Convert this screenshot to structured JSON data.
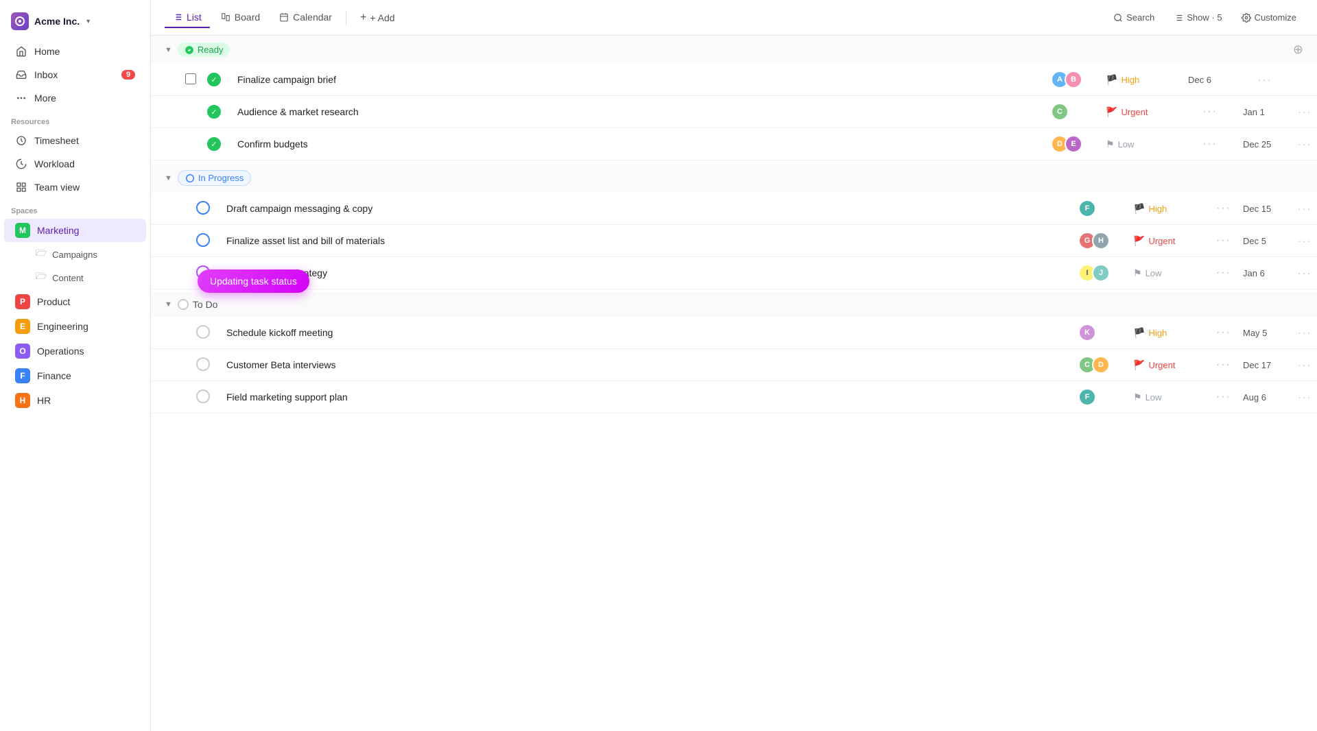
{
  "app": {
    "company": "Acme Inc.",
    "company_arrow": "▾"
  },
  "sidebar": {
    "nav": [
      {
        "id": "home",
        "label": "Home",
        "icon": "home"
      },
      {
        "id": "inbox",
        "label": "Inbox",
        "icon": "inbox",
        "badge": "9"
      },
      {
        "id": "more",
        "label": "More",
        "icon": "more"
      }
    ],
    "resources_label": "Resources",
    "resources": [
      {
        "id": "timesheet",
        "label": "Timesheet",
        "icon": "timesheet"
      },
      {
        "id": "workload",
        "label": "Workload",
        "icon": "workload"
      },
      {
        "id": "teamview",
        "label": "Team view",
        "icon": "teamview"
      }
    ],
    "spaces_label": "Spaces",
    "spaces": [
      {
        "id": "marketing",
        "label": "Marketing",
        "letter": "M",
        "color": "m",
        "active": true,
        "children": [
          "Campaigns",
          "Content"
        ]
      },
      {
        "id": "product",
        "label": "Product",
        "letter": "P",
        "color": "p"
      },
      {
        "id": "engineering",
        "label": "Engineering",
        "letter": "E",
        "color": "e"
      },
      {
        "id": "operations",
        "label": "Operations",
        "letter": "O",
        "color": "o"
      },
      {
        "id": "finance",
        "label": "Finance",
        "letter": "F",
        "color": "f"
      },
      {
        "id": "hr",
        "label": "HR",
        "letter": "H",
        "color": "h"
      }
    ]
  },
  "topbar": {
    "tabs": [
      {
        "id": "list",
        "label": "List",
        "icon": "list",
        "active": true
      },
      {
        "id": "board",
        "label": "Board",
        "icon": "board"
      },
      {
        "id": "calendar",
        "label": "Calendar",
        "icon": "calendar"
      }
    ],
    "add_label": "+ Add",
    "search_label": "Search",
    "show_label": "Show · 5",
    "customize_label": "Customize"
  },
  "sections": [
    {
      "id": "ready",
      "label": "Ready",
      "type": "ready",
      "icon": "check-circle",
      "tasks": [
        {
          "id": "t1",
          "name": "Finalize campaign brief",
          "status": "done",
          "assignees": [
            "a1",
            "a2"
          ],
          "priority": "High",
          "priority_type": "high",
          "date": "Dec 6",
          "has_checkbox": true
        },
        {
          "id": "t2",
          "name": "Audience & market research",
          "status": "done",
          "assignees": [
            "a3"
          ],
          "priority": "Urgent",
          "priority_type": "urgent",
          "date": "Jan 1"
        },
        {
          "id": "t3",
          "name": "Confirm budgets",
          "status": "done",
          "assignees": [
            "a4",
            "a5"
          ],
          "priority": "Low",
          "priority_type": "low",
          "date": "Dec 25"
        }
      ]
    },
    {
      "id": "inprogress",
      "label": "In Progress",
      "type": "inprogress",
      "tasks": [
        {
          "id": "t4",
          "name": "Draft campaign messaging & copy",
          "status": "inprogress",
          "assignees": [
            "a6"
          ],
          "priority": "High",
          "priority_type": "high",
          "date": "Dec 15"
        },
        {
          "id": "t5",
          "name": "Finalize asset list and bill of materials",
          "status": "inprogress",
          "assignees": [
            "a7",
            "a8"
          ],
          "priority": "Urgent",
          "priority_type": "urgent",
          "date": "Dec 5"
        },
        {
          "id": "t6",
          "name": "Define channel strategy",
          "status": "clicking",
          "assignees": [
            "a9",
            "a10"
          ],
          "priority": "Low",
          "priority_type": "low",
          "date": "Jan 6",
          "tooltip": "Updating task status"
        }
      ]
    },
    {
      "id": "todo",
      "label": "To Do",
      "type": "todo",
      "tasks": [
        {
          "id": "t7",
          "name": "Schedule kickoff meeting",
          "status": "todo",
          "assignees": [
            "a11"
          ],
          "priority": "High",
          "priority_type": "high",
          "date": "May 5"
        },
        {
          "id": "t8",
          "name": "Customer Beta interviews",
          "status": "todo",
          "assignees": [
            "a3",
            "a4"
          ],
          "priority": "Urgent",
          "priority_type": "urgent",
          "date": "Dec 17"
        },
        {
          "id": "t9",
          "name": "Field marketing support plan",
          "status": "todo",
          "assignees": [
            "a6"
          ],
          "priority": "Low",
          "priority_type": "low",
          "date": "Aug 6"
        }
      ]
    }
  ],
  "avatars": {
    "a1": {
      "initials": "A",
      "class": "avatar-a1"
    },
    "a2": {
      "initials": "B",
      "class": "avatar-a2"
    },
    "a3": {
      "initials": "C",
      "class": "avatar-a3"
    },
    "a4": {
      "initials": "D",
      "class": "avatar-a4"
    },
    "a5": {
      "initials": "E",
      "class": "avatar-a5"
    },
    "a6": {
      "initials": "F",
      "class": "avatar-a6"
    },
    "a7": {
      "initials": "G",
      "class": "avatar-a7"
    },
    "a8": {
      "initials": "H",
      "class": "avatar-a8"
    },
    "a9": {
      "initials": "I",
      "class": "avatar-a9"
    },
    "a10": {
      "initials": "J",
      "class": "avatar-a10"
    },
    "a11": {
      "initials": "K",
      "class": "avatar-a11"
    }
  }
}
